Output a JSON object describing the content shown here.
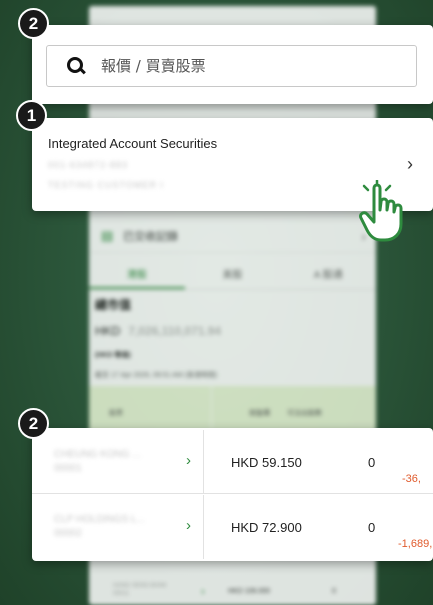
{
  "background_phone": {
    "settled_records_label": "已交收記錄",
    "market_tabs": [
      "港股",
      "美股",
      "A 股通"
    ],
    "market_value_title": "總市值",
    "market_value_currency": "HKD",
    "market_value_amount": "7,026,110,071.94",
    "market_value_sub": "(HKD 等值)",
    "as_of": "截至 17 Apr 2026, 09:51 AM (香港時間)",
    "table_headers": [
      "股票",
      "按盤價",
      "可沽出股數"
    ],
    "bottom_row": {
      "name_line1": "HANG SENG BANK",
      "name_line2": "00011",
      "price": "HKD 106.000",
      "qty": "0"
    }
  },
  "search": {
    "placeholder": "報價 / 買賣股票"
  },
  "account": {
    "title": "Integrated Account Securities",
    "account_number": "001-634872-883",
    "account_name": "TESTING CUSTOMER I"
  },
  "holdings": [
    {
      "name_line1": "CHEUNG KONG ...",
      "name_line2": "00001",
      "price": "HKD 59.150",
      "qty": "0",
      "pl": "-36,"
    },
    {
      "name_line1": "CLP HOLDINGS L...",
      "name_line2": "00002",
      "price": "HKD 72.900",
      "qty": "0",
      "pl": "-1,689,"
    }
  ],
  "badges": {
    "search_step": "2",
    "account_step": "1",
    "holdings_step": "2"
  },
  "colors": {
    "accent_green": "#2e8b3e",
    "loss_red": "#e05a2c",
    "backdrop": "#2c573b"
  },
  "icons": {
    "search": "search-icon",
    "chevron": "chevron-right-icon",
    "pointer": "pointer-hand-icon",
    "settled": "receipt-icon"
  }
}
